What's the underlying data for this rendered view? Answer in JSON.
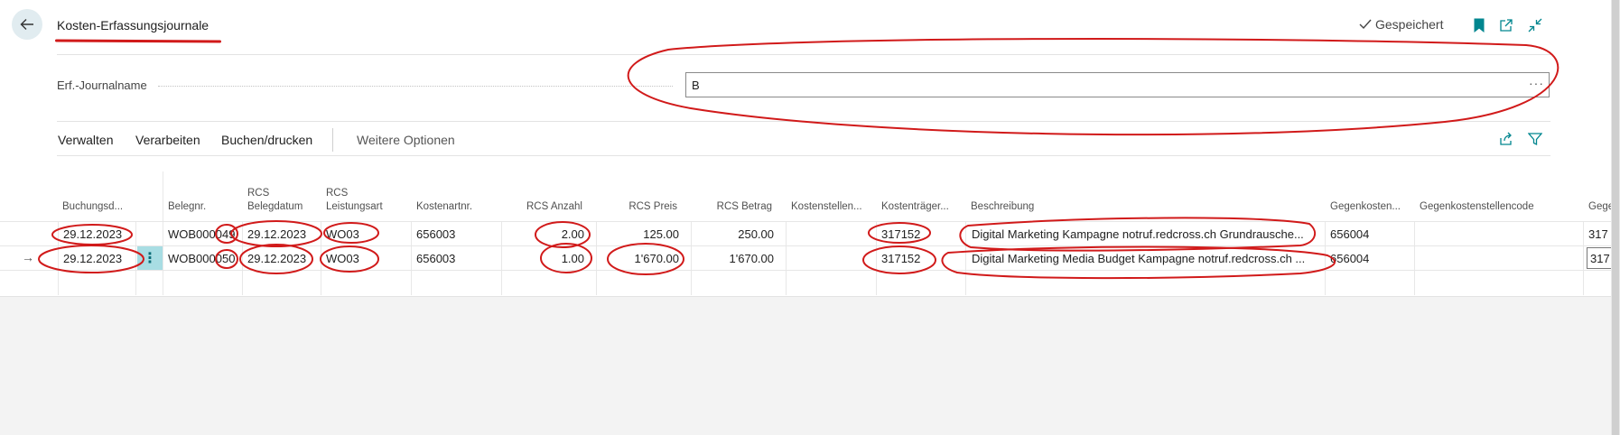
{
  "header": {
    "title": "Kosten-Erfassungsjournale",
    "saved_label": "Gespeichert",
    "back_icon": "arrow-left-icon",
    "bookmark_icon": "bookmark-icon",
    "open_new_icon": "open-in-new-window-icon",
    "collapse_icon": "collapse-icon",
    "accent_color": "#00868f"
  },
  "journal_field": {
    "label": "Erf.-Journalname",
    "value": "B",
    "ellipsis": "···"
  },
  "actions": {
    "manage": "Verwalten",
    "process": "Verarbeiten",
    "post_print": "Buchen/drucken",
    "more_options": "Weitere Optionen",
    "share_icon": "share-icon",
    "filter_icon": "filter-icon"
  },
  "grid": {
    "headers": {
      "posting_date": "Buchungsd...",
      "doc_no": "Belegnr.",
      "rcs_doc_date_1": "RCS",
      "rcs_doc_date_2": "Belegdatum",
      "rcs_service_1": "RCS",
      "rcs_service_2": "Leistungsart",
      "cost_type": "Kostenartnr.",
      "rcs_qty": "RCS Anzahl",
      "rcs_price": "RCS Preis",
      "rcs_amount": "RCS Betrag",
      "cost_center": "Kostenstellen...",
      "cost_object": "Kostenträger...",
      "description": "Beschreibung",
      "bal_cost": "Gegenkosten...",
      "bal_cost_center": "Gegenkostenstellencode",
      "bal_more": "Gege"
    },
    "rows": [
      {
        "posting_date": "29.12.2023",
        "doc_no": "WOB000049",
        "rcs_doc_date": "29.12.2023",
        "rcs_service": "WO03",
        "cost_type": "656003",
        "rcs_qty": "2.00",
        "rcs_price": "125.00",
        "rcs_amount": "250.00",
        "cost_center": "",
        "cost_object": "317152",
        "description": "Digital Marketing Kampagne notruf.redcross.ch Grundrausche...",
        "bal_cost": "656004",
        "bal_cost_center": "",
        "bal_more": "317"
      },
      {
        "posting_date": "29.12.2023",
        "doc_no": "WOB000050",
        "rcs_doc_date": "29.12.2023",
        "rcs_service": "WO03",
        "cost_type": "656003",
        "rcs_qty": "1.00",
        "rcs_price": "1'670.00",
        "rcs_amount": "1'670.00",
        "cost_center": "",
        "cost_object": "317152",
        "description": "Digital Marketing Media Budget Kampagne notruf.redcross.ch ...",
        "bal_cost": "656004",
        "bal_cost_center": "",
        "bal_more": "317"
      }
    ],
    "row_arrow": "→",
    "row_menu": "⋮"
  }
}
